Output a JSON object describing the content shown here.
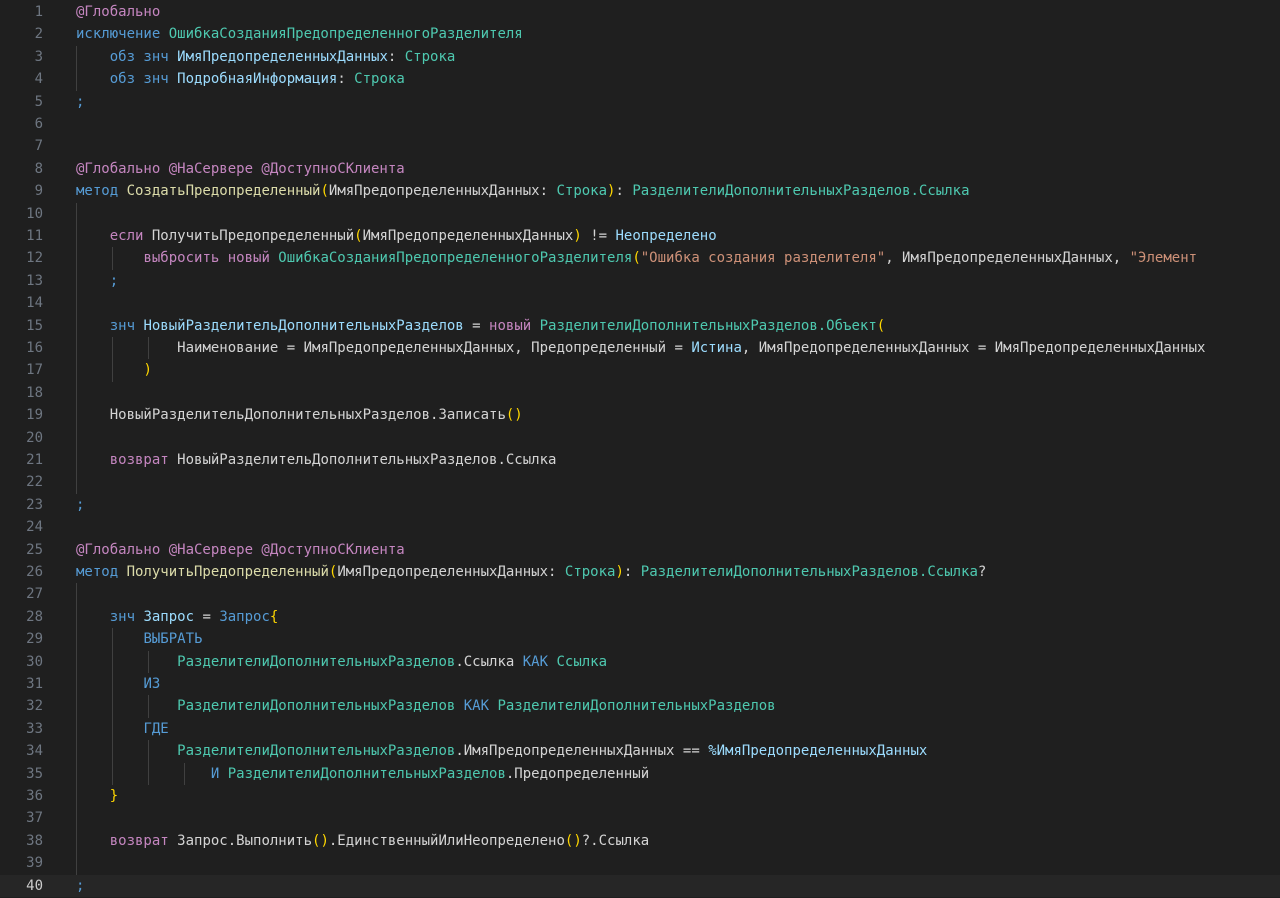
{
  "editor": {
    "current_line": 40,
    "colors": {
      "background": "#1f1f1f",
      "current_line_bg": "#262626",
      "line_number": "#6e7681",
      "line_number_active": "#cccccc",
      "indent_guide": "#404040",
      "keyword": "#569cd6",
      "control": "#c586c0",
      "type": "#4ec9b0",
      "function": "#dcdcaa",
      "variable": "#9cdcfe",
      "string": "#ce9178",
      "bracket": "#ffd700",
      "text": "#d4d4d4"
    },
    "lines": [
      {
        "n": "1",
        "tokens": [
          {
            "t": "@Глобально",
            "k": "control"
          }
        ]
      },
      {
        "n": "2",
        "tokens": [
          {
            "t": "исключение ",
            "k": "keyword"
          },
          {
            "t": "ОшибкаСозданияПредопределенногоРазделителя",
            "k": "type"
          }
        ]
      },
      {
        "n": "3",
        "tokens": [
          {
            "t": "    "
          },
          {
            "t": "обз знч ",
            "k": "keyword"
          },
          {
            "t": "ИмяПредопределенныхДанных",
            "k": "variable"
          },
          {
            "t": ": "
          },
          {
            "t": "Строка",
            "k": "type"
          }
        ]
      },
      {
        "n": "4",
        "tokens": [
          {
            "t": "    "
          },
          {
            "t": "обз знч ",
            "k": "keyword"
          },
          {
            "t": "ПодробнаяИнформация",
            "k": "variable"
          },
          {
            "t": ": "
          },
          {
            "t": "Строка",
            "k": "type"
          }
        ]
      },
      {
        "n": "5",
        "tokens": [
          {
            "t": ";",
            "k": "keyword"
          }
        ]
      },
      {
        "n": "6",
        "tokens": []
      },
      {
        "n": "7",
        "tokens": []
      },
      {
        "n": "8",
        "tokens": [
          {
            "t": "@Глобально @НаСервере @ДоступноСКлиента",
            "k": "control"
          }
        ]
      },
      {
        "n": "9",
        "tokens": [
          {
            "t": "метод ",
            "k": "keyword"
          },
          {
            "t": "СоздатьПредопределенный",
            "k": "function"
          },
          {
            "t": "(",
            "k": "bracket"
          },
          {
            "t": "ИмяПредопределенныхДанных: "
          },
          {
            "t": "Строка",
            "k": "type"
          },
          {
            "t": ")",
            "k": "bracket"
          },
          {
            "t": ": "
          },
          {
            "t": "РазделителиДополнительныхРазделов.Ссылка",
            "k": "type"
          }
        ]
      },
      {
        "n": "10",
        "tokens": []
      },
      {
        "n": "11",
        "tokens": [
          {
            "t": "    "
          },
          {
            "t": "если ",
            "k": "control"
          },
          {
            "t": "ПолучитьПредопределенный"
          },
          {
            "t": "(",
            "k": "bracket"
          },
          {
            "t": "ИмяПредопределенныхДанных"
          },
          {
            "t": ")",
            "k": "bracket"
          },
          {
            "t": " != "
          },
          {
            "t": "Неопределено",
            "k": "variable"
          }
        ]
      },
      {
        "n": "12",
        "tokens": [
          {
            "t": "        "
          },
          {
            "t": "выбросить новый ",
            "k": "control"
          },
          {
            "t": "ОшибкаСозданияПредопределенногоРазделителя",
            "k": "type"
          },
          {
            "t": "(",
            "k": "bracket"
          },
          {
            "t": "\"Ошибка создания разделителя\"",
            "k": "string"
          },
          {
            "t": ", ИмяПредопределенныхДанных, "
          },
          {
            "t": "\"Элемент",
            "k": "string"
          }
        ]
      },
      {
        "n": "13",
        "tokens": [
          {
            "t": "    "
          },
          {
            "t": ";",
            "k": "keyword"
          }
        ]
      },
      {
        "n": "14",
        "tokens": []
      },
      {
        "n": "15",
        "tokens": [
          {
            "t": "    "
          },
          {
            "t": "знч ",
            "k": "keyword"
          },
          {
            "t": "НовыйРазделительДополнительныхРазделов",
            "k": "variable"
          },
          {
            "t": " = "
          },
          {
            "t": "новый ",
            "k": "control"
          },
          {
            "t": "РазделителиДополнительныхРазделов.Объект",
            "k": "type"
          },
          {
            "t": "(",
            "k": "bracket"
          }
        ]
      },
      {
        "n": "16",
        "tokens": [
          {
            "t": "        "
          },
          {
            "t": "    Наименование = ИмяПредопределенныхДанных, Предопределенный = "
          },
          {
            "t": "Истина",
            "k": "variable"
          },
          {
            "t": ", ИмяПредопределенныхДанных = ИмяПредопределенныхДанных"
          }
        ]
      },
      {
        "n": "17",
        "tokens": [
          {
            "t": "        "
          },
          {
            "t": ")",
            "k": "bracket"
          }
        ]
      },
      {
        "n": "18",
        "tokens": []
      },
      {
        "n": "19",
        "tokens": [
          {
            "t": "    "
          },
          {
            "t": "НовыйРазделительДополнительныхРазделов.Записать"
          },
          {
            "t": "()",
            "k": "bracket"
          }
        ]
      },
      {
        "n": "20",
        "tokens": []
      },
      {
        "n": "21",
        "tokens": [
          {
            "t": "    "
          },
          {
            "t": "возврат ",
            "k": "control"
          },
          {
            "t": "НовыйРазделительДополнительныхРазделов.Ссылка"
          }
        ]
      },
      {
        "n": "22",
        "tokens": []
      },
      {
        "n": "23",
        "tokens": [
          {
            "t": ";",
            "k": "keyword"
          }
        ]
      },
      {
        "n": "24",
        "tokens": []
      },
      {
        "n": "25",
        "tokens": [
          {
            "t": "@Глобально @НаСервере @ДоступноСКлиента",
            "k": "control"
          }
        ]
      },
      {
        "n": "26",
        "tokens": [
          {
            "t": "метод ",
            "k": "keyword"
          },
          {
            "t": "ПолучитьПредопределенный",
            "k": "function"
          },
          {
            "t": "(",
            "k": "bracket"
          },
          {
            "t": "ИмяПредопределенныхДанных: "
          },
          {
            "t": "Строка",
            "k": "type"
          },
          {
            "t": ")",
            "k": "bracket"
          },
          {
            "t": ": "
          },
          {
            "t": "РазделителиДополнительныхРазделов.Ссылка",
            "k": "type"
          },
          {
            "t": "?"
          }
        ]
      },
      {
        "n": "27",
        "tokens": []
      },
      {
        "n": "28",
        "tokens": [
          {
            "t": "    "
          },
          {
            "t": "знч ",
            "k": "keyword"
          },
          {
            "t": "Запрос",
            "k": "variable"
          },
          {
            "t": " = "
          },
          {
            "t": "Запрос",
            "k": "keyword"
          },
          {
            "t": "{",
            "k": "bracket"
          }
        ]
      },
      {
        "n": "29",
        "tokens": [
          {
            "t": "        "
          },
          {
            "t": "ВЫБРАТЬ",
            "k": "keyword"
          }
        ]
      },
      {
        "n": "30",
        "tokens": [
          {
            "t": "            "
          },
          {
            "t": "РазделителиДополнительныхРазделов",
            "k": "type"
          },
          {
            "t": ".Ссылка "
          },
          {
            "t": "КАК ",
            "k": "keyword"
          },
          {
            "t": "Ссылка",
            "k": "type"
          }
        ]
      },
      {
        "n": "31",
        "tokens": [
          {
            "t": "        "
          },
          {
            "t": "ИЗ",
            "k": "keyword"
          }
        ]
      },
      {
        "n": "32",
        "tokens": [
          {
            "t": "            "
          },
          {
            "t": "РазделителиДополнительныхРазделов ",
            "k": "type"
          },
          {
            "t": "КАК ",
            "k": "keyword"
          },
          {
            "t": "РазделителиДополнительныхРазделов",
            "k": "type"
          }
        ]
      },
      {
        "n": "33",
        "tokens": [
          {
            "t": "        "
          },
          {
            "t": "ГДЕ",
            "k": "keyword"
          }
        ]
      },
      {
        "n": "34",
        "tokens": [
          {
            "t": "            "
          },
          {
            "t": "РазделителиДополнительныхРазделов",
            "k": "type"
          },
          {
            "t": ".ИмяПредопределенныхДанных == "
          },
          {
            "t": "%ИмяПредопределенныхДанных",
            "k": "variable"
          }
        ]
      },
      {
        "n": "35",
        "tokens": [
          {
            "t": "                "
          },
          {
            "t": "И ",
            "k": "keyword"
          },
          {
            "t": "РазделителиДополнительныхРазделов",
            "k": "type"
          },
          {
            "t": ".Предопределенный"
          }
        ]
      },
      {
        "n": "36",
        "tokens": [
          {
            "t": "    "
          },
          {
            "t": "}",
            "k": "bracket"
          }
        ]
      },
      {
        "n": "37",
        "tokens": []
      },
      {
        "n": "38",
        "tokens": [
          {
            "t": "    "
          },
          {
            "t": "возврат ",
            "k": "control"
          },
          {
            "t": "Запрос.Выполнить"
          },
          {
            "t": "()",
            "k": "bracket"
          },
          {
            "t": ".ЕдинственныйИлиНеопределено"
          },
          {
            "t": "()",
            "k": "bracket"
          },
          {
            "t": "?.Ссылка"
          }
        ]
      },
      {
        "n": "39",
        "tokens": []
      },
      {
        "n": "40",
        "tokens": [
          {
            "t": ";",
            "k": "keyword"
          }
        ]
      }
    ]
  }
}
